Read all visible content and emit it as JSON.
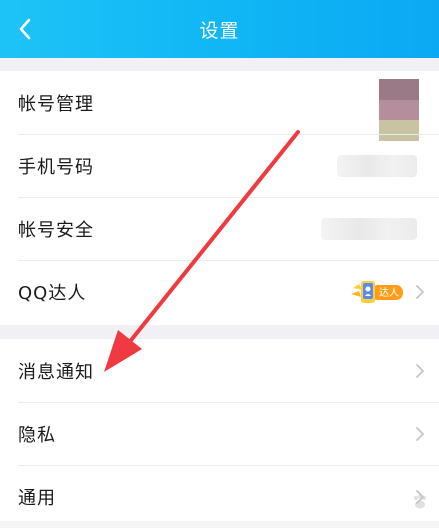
{
  "header": {
    "title": "设置"
  },
  "group1": {
    "rows": [
      {
        "label": "帐号管理"
      },
      {
        "label": "手机号码"
      },
      {
        "label": "帐号安全"
      },
      {
        "label": "QQ达人",
        "badge_text": "达人"
      }
    ]
  },
  "group2": {
    "rows": [
      {
        "label": "消息通知"
      },
      {
        "label": "隐私"
      },
      {
        "label": "通用"
      }
    ]
  },
  "colors": {
    "header_start": "#1ec3f6",
    "header_end": "#0ba9f3",
    "annotation_arrow": "#ef3a42"
  },
  "icons": {
    "back": "chevron-left-icon",
    "row_arrow": "chevron-right-icon",
    "talent": "qq-talent-badge-icon"
  }
}
